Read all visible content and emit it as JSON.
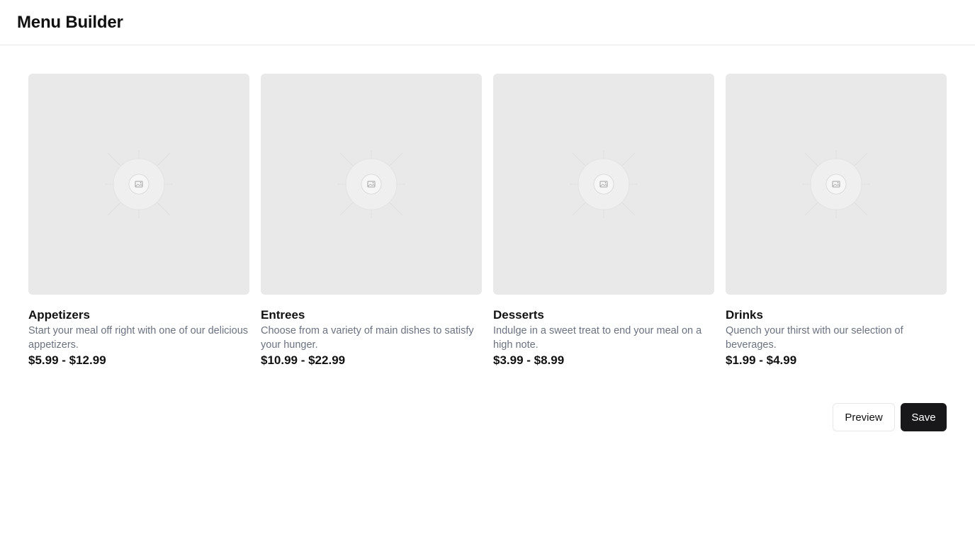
{
  "header": {
    "title": "Menu Builder"
  },
  "categories": [
    {
      "name": "Appetizers",
      "description": "Start your meal off right with one of our delicious appetizers.",
      "price": "$5.99 - $12.99",
      "image_icon": "image-placeholder-icon"
    },
    {
      "name": "Entrees",
      "description": "Choose from a variety of main dishes to satisfy your hunger.",
      "price": "$10.99 - $22.99",
      "image_icon": "image-placeholder-icon"
    },
    {
      "name": "Desserts",
      "description": "Indulge in a sweet treat to end your meal on a high note.",
      "price": "$3.99 - $8.99",
      "image_icon": "image-placeholder-icon"
    },
    {
      "name": "Drinks",
      "description": "Quench your thirst with our selection of beverages.",
      "price": "$1.99 - $4.99",
      "image_icon": "image-placeholder-icon"
    }
  ],
  "actions": {
    "preview_label": "Preview",
    "save_label": "Save"
  },
  "colors": {
    "save_bg": "#18181b",
    "placeholder_bg": "#e9e9e9",
    "muted_text": "#6b7280"
  }
}
